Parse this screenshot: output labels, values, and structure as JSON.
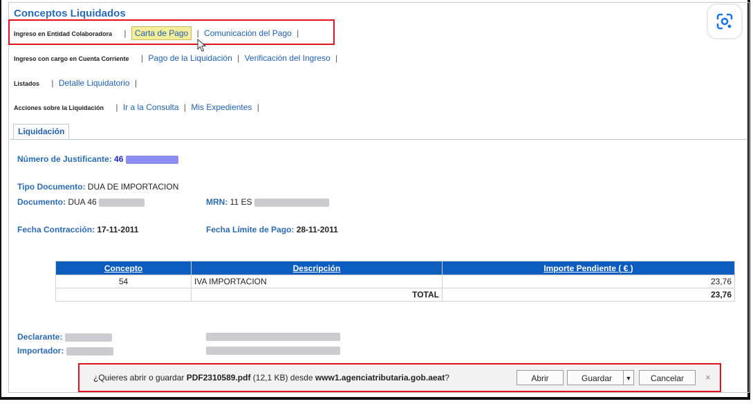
{
  "title": "Conceptos Liquidados",
  "rows": [
    {
      "label": "Ingreso en Entidad Colaboradora",
      "links": [
        "Carta de Pago",
        "Comunicación del Pago"
      ]
    },
    {
      "label": "Ingreso con cargo en Cuenta Corriente",
      "links": [
        "Pago de la Liquidación",
        "Verificación del Ingreso"
      ]
    },
    {
      "label": "Listados",
      "links": [
        "Detalle Liquidatorio"
      ]
    },
    {
      "label": "Acciones sobre la Liquidación",
      "links": [
        "Ir a la Consulta",
        "Mis Expedientes"
      ]
    }
  ],
  "tab": "Liquidación",
  "fields": {
    "justificante_label": "Número de Justificante:",
    "justificante_value": "46",
    "tipo_label": "Tipo Documento:",
    "tipo_value": "DUA DE IMPORTACION",
    "documento_label": "Documento:",
    "documento_value": "DUA 46",
    "mrn_label": "MRN:",
    "mrn_value": "11 ES",
    "fecha_contraccion_label": "Fecha Contracción:",
    "fecha_contraccion_value": "17-11-2011",
    "fecha_limite_label": "Fecha Límite de Pago:",
    "fecha_limite_value": "28-11-2011",
    "declarante_label": "Declarante:",
    "importador_label": "Importador:"
  },
  "table": {
    "headers": [
      "Concepto",
      "Descripción",
      "Importe Pendiente ( € )"
    ],
    "rows": [
      [
        "54",
        "IVA IMPORTACION",
        "23,76"
      ]
    ],
    "total_label": "TOTAL",
    "total_value": "23,76"
  },
  "download": {
    "prefix": "¿Quieres abrir o guardar ",
    "filename": "PDF2310589.pdf",
    "size": " (12,1 KB) desde ",
    "host": "www1.agenciatributaria.gob.aeat",
    "suffix": "?",
    "open_label": "Abrir",
    "save_label": "Guardar",
    "cancel_label": "Cancelar",
    "close_glyph": "×"
  },
  "icons": {
    "lens": "google-lens-icon",
    "cursor": "mouse-pointer-icon",
    "dropdown": "caret-down-icon"
  },
  "colors": {
    "link": "#1f5fb0",
    "header_bg": "#0d5cc0",
    "highlight": "#e0121b",
    "total": "#1c25c8"
  }
}
